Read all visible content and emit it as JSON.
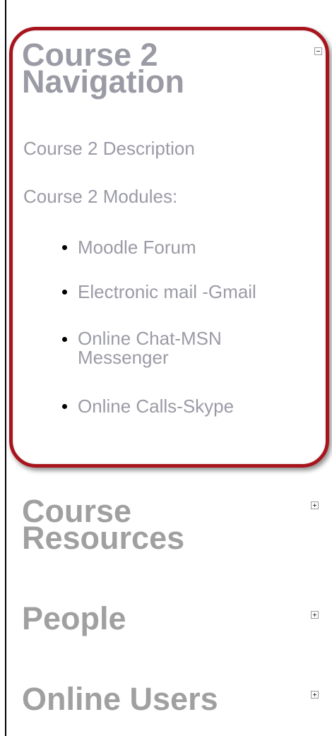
{
  "course_navigation": {
    "title": "Course 2 Navigation",
    "toggle_icon": "minus-box-icon",
    "description_link": "Course 2 Description",
    "modules_label": "Course 2 Modules:",
    "modules": [
      "Moodle Forum",
      "Electronic mail -Gmail",
      "Online Chat-MSN Messenger",
      "Online Calls-Skype"
    ]
  },
  "blocks": [
    {
      "title": "Course Resources",
      "toggle_icon": "plus-box-icon"
    },
    {
      "title": "People",
      "toggle_icon": "plus-box-icon"
    },
    {
      "title": "Online Users",
      "toggle_icon": "plus-box-icon"
    }
  ],
  "colors": {
    "highlight_frame": "#a8141d",
    "link_text": "#9b9ba6",
    "block_title": "#a0a0a0"
  }
}
